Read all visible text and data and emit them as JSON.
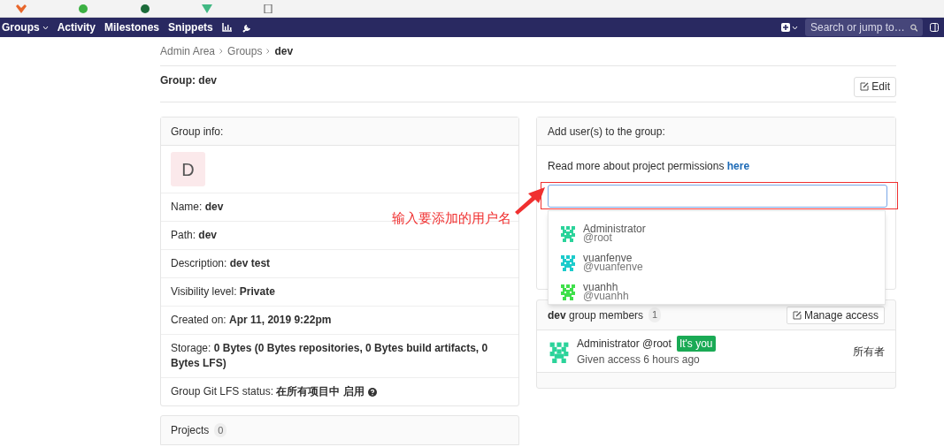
{
  "navbar": {
    "items": [
      {
        "label": "Groups",
        "kind": "dropdown"
      },
      {
        "label": "Activity",
        "kind": "link"
      },
      {
        "label": "Milestones",
        "kind": "link"
      },
      {
        "label": "Snippets",
        "kind": "link"
      }
    ],
    "search": {
      "placeholder": "Search or jump to…"
    }
  },
  "breadcrumb": [
    "Admin Area",
    "Groups",
    "dev"
  ],
  "page_title": "Group: dev",
  "edit_button": "Edit",
  "group_info": {
    "title": "Group info:",
    "avatar_letter": "D",
    "rows": [
      {
        "label": "Name:",
        "value": "dev"
      },
      {
        "label": "Path:",
        "value": "dev"
      },
      {
        "label": "Description:",
        "value": "dev test"
      },
      {
        "label": "Visibility level:",
        "value": "Private"
      },
      {
        "label": "Created on:",
        "value": "Apr 11, 2019 9:22pm"
      },
      {
        "label": "Storage:",
        "value": "0 Bytes (0 Bytes repositories, 0 Bytes build artifacts, 0 Bytes LFS)"
      },
      {
        "label": "Group Git LFS status:",
        "value": "在所有项目中 启用",
        "help": true
      }
    ]
  },
  "projects": {
    "title": "Projects",
    "count": "0"
  },
  "add_users": {
    "title": "Add user(s) to the group:",
    "note": "Read more about project permissions",
    "link": "here",
    "suggestions": [
      {
        "name": "Administrator",
        "username": "@root",
        "color": "#2bd39a"
      },
      {
        "name": "vuanfenve",
        "username": "@vuanfenve",
        "color": "#1ccbcb"
      },
      {
        "name": "vuanhh",
        "username": "@vuanhh",
        "color": "#3fe04a"
      }
    ]
  },
  "members": {
    "group": "dev",
    "title": "group members",
    "count": "1",
    "manage_button": "Manage access",
    "list": [
      {
        "name": "Administrator",
        "username": "@root",
        "badge": "It's you",
        "access": "Given access 6 hours ago",
        "role": "所有者",
        "color": "#2bd39a"
      }
    ]
  },
  "annotation": {
    "text": "输入要添加的用户名"
  }
}
